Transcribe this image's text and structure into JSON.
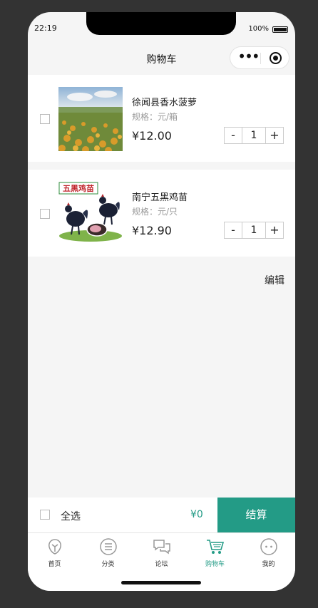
{
  "status": {
    "time": "22:19",
    "battery": "100%"
  },
  "nav": {
    "title": "购物车"
  },
  "cart": {
    "items": [
      {
        "name": "徐闻县香水菠萝",
        "spec": "规格：元/箱",
        "price": "¥12.00",
        "quantity": "1",
        "image": "pineapple-field-photo"
      },
      {
        "name": "南宁五黑鸡苗",
        "spec": "规格：元/只",
        "price": "¥12.90",
        "quantity": "1",
        "image": "black-chicken-photo",
        "image_caption": "五黑鸡苗"
      }
    ],
    "stepper_minus": "-",
    "stepper_plus": "+"
  },
  "edit_label": "编辑",
  "bottom_bar": {
    "select_all": "全选",
    "total": "¥0",
    "checkout": "结算"
  },
  "tabbar": {
    "accent": "#239b86",
    "tabs": [
      {
        "label": "首页",
        "icon": "home-icon"
      },
      {
        "label": "分类",
        "icon": "category-icon"
      },
      {
        "label": "论坛",
        "icon": "forum-icon"
      },
      {
        "label": "购物车",
        "icon": "cart-icon",
        "active": true
      },
      {
        "label": "我的",
        "icon": "profile-icon"
      }
    ]
  }
}
